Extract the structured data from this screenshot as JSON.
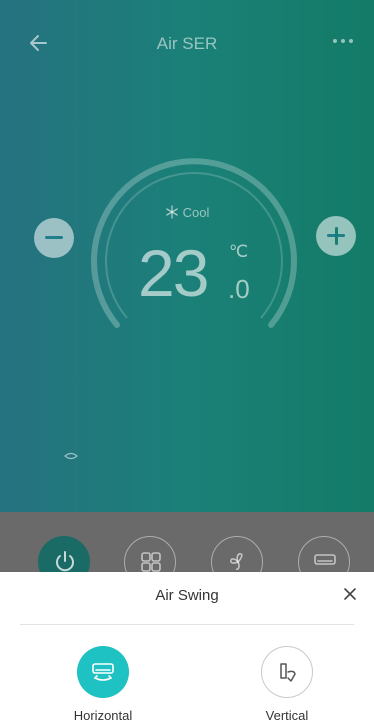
{
  "header": {
    "title": "Air SER",
    "back_icon": "arrow-left-icon",
    "more_icon": "more-dots-icon"
  },
  "thermostat": {
    "mode_label": "Cool",
    "mode_icon": "snowflake-icon",
    "temperature_integer": "23",
    "temperature_decimal": ".0",
    "unit": "℃"
  },
  "controls": [
    {
      "name": "power",
      "icon": "power-icon",
      "active": true
    },
    {
      "name": "mode",
      "icon": "mode-grid-icon",
      "active": false
    },
    {
      "name": "fan",
      "icon": "fan-icon",
      "active": false
    },
    {
      "name": "swing",
      "icon": "ac-unit-icon",
      "active": false
    }
  ],
  "sheet": {
    "title": "Air Swing",
    "options": [
      {
        "label": "Horizontal",
        "icon": "horizontal-swing-icon",
        "selected": true
      },
      {
        "label": "Vertical",
        "icon": "vertical-swing-icon",
        "selected": false
      }
    ]
  },
  "colors": {
    "accent": "#1ec2c2",
    "gradient_left": "#2a7f8f",
    "gradient_right": "#168a73",
    "overlay": "#6a6a6a"
  }
}
